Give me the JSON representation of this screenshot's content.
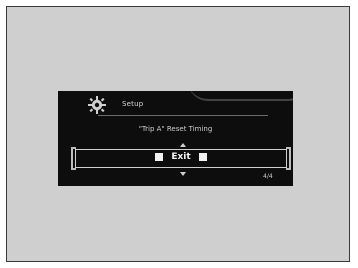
{
  "screen": {
    "header": {
      "icon": "gear-icon",
      "label": "Setup"
    },
    "setting_title": "\"Trip A\" Reset Timing",
    "selected_option": "Exit",
    "page_indicator": "4/4",
    "arrows": [
      "up-arrow-icon",
      "down-arrow-icon"
    ]
  },
  "colors": {
    "figure_background": "#cfcfcf",
    "screen_background": "#0d0d0d",
    "text": "#d8d8d8",
    "highlight": "#f5f5f5"
  }
}
